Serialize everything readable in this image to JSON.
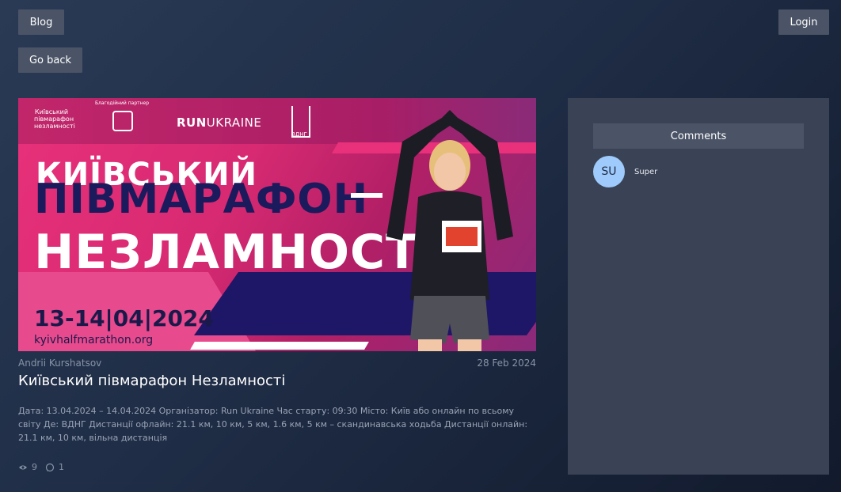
{
  "nav": {
    "blog_label": "Blog",
    "login_label": "Login",
    "go_back_label": "Go back"
  },
  "hero": {
    "logo_text_1": "Київський півмарафон незламності",
    "logo_text_2": "Благодійний партнер",
    "run_logo_bold": "RUN",
    "run_logo_thin": "UKRAINE",
    "vdng_label": "ВДНГ",
    "title_line_1": "КИЇВСЬКИЙ",
    "title_line_2": "ПІВМАРАФОН",
    "title_line_3": "НЕЗЛАМНОСТІ",
    "dates": "13-14|04|2024",
    "url": "kyivhalfmarathon.org"
  },
  "post": {
    "author": "Andrii Kurshatsov",
    "date": "28 Feb 2024",
    "title": "Київський півмарафон Незламності",
    "body": "Дата: 13.04.2024 – 14.04.2024 Організатор: Run Ukraine Час старту: 09:30 Місто: Київ або онлайн по всьому світу Де: ВДНГ Дистанції офлайн: 21.1 км, 10 км, 5 км, 1.6 км, 5 км – скандинавська ходьба Дистанції онлайн: 21.1 км, 10 км, вільна дистанція",
    "views": "9",
    "comments_count": "1"
  },
  "comments": {
    "header": "Comments",
    "items": [
      {
        "initials": "SU",
        "text": "Super"
      }
    ]
  },
  "colors": {
    "button_bg": "#4b5466",
    "panel_bg": "#3a4355",
    "avatar_bg": "#9ecbfb",
    "hero_pink": "#e8317a",
    "hero_navy": "#1e1666"
  }
}
